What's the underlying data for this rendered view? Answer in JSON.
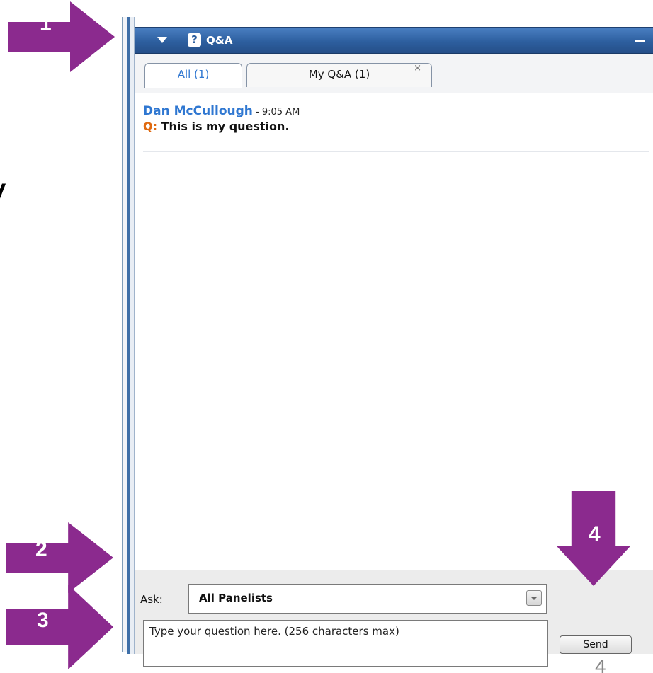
{
  "panel": {
    "title": "Q&A",
    "icon_glyph": "?"
  },
  "tabs": [
    {
      "label": "All (1)",
      "active": true
    },
    {
      "label": "My Q&A (1)",
      "active": false,
      "close_glyph": "×"
    }
  ],
  "messages": [
    {
      "sender": "Dan McCullough",
      "time": " - 9:05 AM",
      "prefix": "Q:",
      "text": " This is my question."
    }
  ],
  "ask": {
    "label": "Ask:",
    "selected": "All Panelists",
    "placeholder": "Type your question here. (256 characters max)",
    "send_label": "Send"
  },
  "callouts": {
    "one": "1",
    "two": "2",
    "three": "3",
    "four": "4"
  },
  "edge_mark": "/",
  "page_number": "4",
  "colors": {
    "header_blue": "#2d5f9f",
    "link_blue": "#2f77d1",
    "question_orange": "#e06a10",
    "callout_purple": "#8b2a8e"
  }
}
